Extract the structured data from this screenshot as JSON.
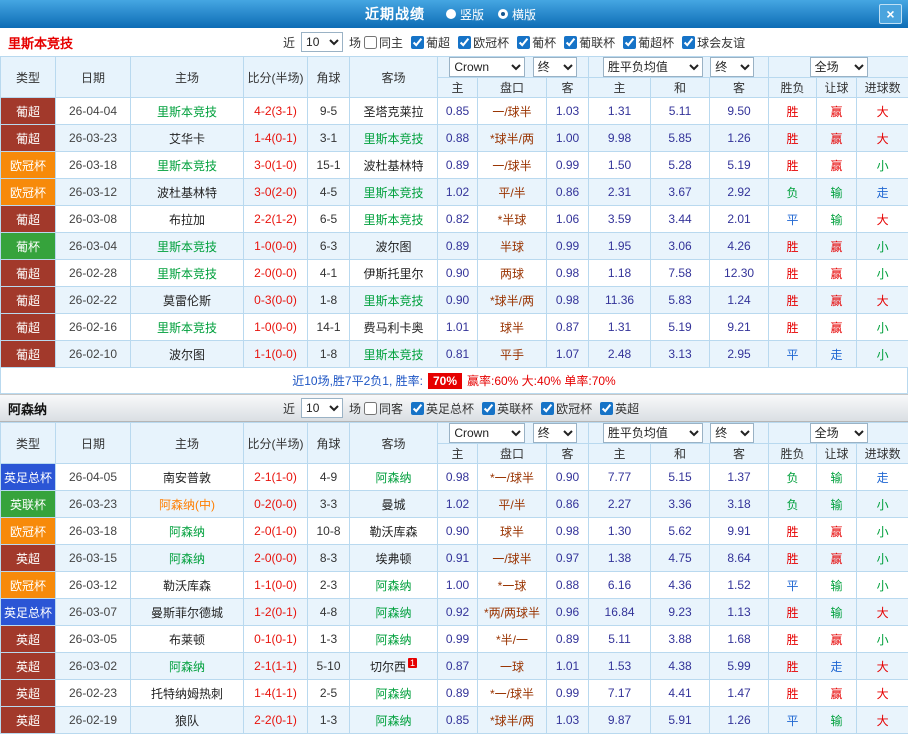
{
  "titlebar": {
    "title": "近期战绩",
    "options": [
      {
        "label": "竖版",
        "selected": false
      },
      {
        "label": "横版",
        "selected": true
      }
    ],
    "close": "×"
  },
  "league_colors": {
    "葡超": "#a2392b",
    "英超": "#a2392b",
    "欧冠杯": "#f78a0a",
    "葡杯": "#36a33c",
    "英联杯": "#36a33c",
    "英足总杯": "#2b55d5"
  },
  "result_classes": {
    "胜": "win",
    "赢": "win",
    "大": "win",
    "平": "push",
    "走": "push",
    "负": "loss",
    "输": "loss",
    "小": "loss"
  },
  "sections": [
    {
      "team": "里斯本竞技",
      "filters": {
        "near": "近",
        "count": "10",
        "games": "场",
        "checkboxes": [
          {
            "label": "同主",
            "checked": false
          },
          {
            "label": "葡超",
            "checked": true
          },
          {
            "label": "欧冠杯",
            "checked": true
          },
          {
            "label": "葡杯",
            "checked": true
          },
          {
            "label": "葡联杯",
            "checked": true
          },
          {
            "label": "葡超杯",
            "checked": true
          },
          {
            "label": "球会友谊",
            "checked": true
          }
        ]
      },
      "headers": {
        "type": "类型",
        "date": "日期",
        "home": "主场",
        "score": "比分(半场)",
        "corner": "角球",
        "away": "客场",
        "book": "Crown",
        "final1": "终",
        "avg": "胜平负均值",
        "final2": "终",
        "scope": "全场",
        "sub": [
          "主",
          "盘口",
          "客",
          "主",
          "和",
          "客",
          "胜负",
          "让球",
          "进球数"
        ]
      },
      "rows": [
        {
          "league": "葡超",
          "date": "26-04-04",
          "home": "里斯本竞技",
          "home_style": "self",
          "score": "4-2(3-1)",
          "corners": "9-5",
          "away": "圣塔克莱拉",
          "away_style": "",
          "asian": [
            "0.85",
            "一/球半",
            "1.03"
          ],
          "euro": [
            "1.31",
            "5.11",
            "9.50"
          ],
          "results": [
            "胜",
            "赢",
            "大"
          ]
        },
        {
          "league": "葡超",
          "date": "26-03-23",
          "home": "艾华卡",
          "home_style": "",
          "score": "1-4(0-1)",
          "corners": "3-1",
          "away": "里斯本竞技",
          "away_style": "self",
          "asian": [
            "0.88",
            "*球半/两",
            "1.00"
          ],
          "euro": [
            "9.98",
            "5.85",
            "1.26"
          ],
          "results": [
            "胜",
            "赢",
            "大"
          ]
        },
        {
          "league": "欧冠杯",
          "date": "26-03-18",
          "home": "里斯本竞技",
          "home_style": "self",
          "score": "3-0(1-0)",
          "corners": "15-1",
          "away": "波杜基林特",
          "away_style": "",
          "asian": [
            "0.89",
            "一/球半",
            "0.99"
          ],
          "euro": [
            "1.50",
            "5.28",
            "5.19"
          ],
          "results": [
            "胜",
            "赢",
            "小"
          ]
        },
        {
          "league": "欧冠杯",
          "date": "26-03-12",
          "home": "波杜基林特",
          "home_style": "",
          "score": "3-0(2-0)",
          "corners": "4-5",
          "away": "里斯本竞技",
          "away_style": "self",
          "asian": [
            "1.02",
            "平/半",
            "0.86"
          ],
          "euro": [
            "2.31",
            "3.67",
            "2.92"
          ],
          "results": [
            "负",
            "输",
            "走"
          ]
        },
        {
          "league": "葡超",
          "date": "26-03-08",
          "home": "布拉加",
          "home_style": "",
          "score": "2-2(1-2)",
          "corners": "6-5",
          "away": "里斯本竞技",
          "away_style": "self",
          "asian": [
            "0.82",
            "*半球",
            "1.06"
          ],
          "euro": [
            "3.59",
            "3.44",
            "2.01"
          ],
          "results": [
            "平",
            "输",
            "大"
          ]
        },
        {
          "league": "葡杯",
          "date": "26-03-04",
          "home": "里斯本竞技",
          "home_style": "self",
          "score": "1-0(0-0)",
          "corners": "6-3",
          "away": "波尔图",
          "away_style": "",
          "asian": [
            "0.89",
            "半球",
            "0.99"
          ],
          "euro": [
            "1.95",
            "3.06",
            "4.26"
          ],
          "results": [
            "胜",
            "赢",
            "小"
          ]
        },
        {
          "league": "葡超",
          "date": "26-02-28",
          "home": "里斯本竞技",
          "home_style": "self",
          "score": "2-0(0-0)",
          "corners": "4-1",
          "away": "伊斯托里尔",
          "away_style": "",
          "asian": [
            "0.90",
            "两球",
            "0.98"
          ],
          "euro": [
            "1.18",
            "7.58",
            "12.30"
          ],
          "results": [
            "胜",
            "赢",
            "小"
          ]
        },
        {
          "league": "葡超",
          "date": "26-02-22",
          "home": "莫雷伦斯",
          "home_style": "",
          "score": "0-3(0-0)",
          "corners": "1-8",
          "away": "里斯本竞技",
          "away_style": "self",
          "asian": [
            "0.90",
            "*球半/两",
            "0.98"
          ],
          "euro": [
            "11.36",
            "5.83",
            "1.24"
          ],
          "results": [
            "胜",
            "赢",
            "大"
          ]
        },
        {
          "league": "葡超",
          "date": "26-02-16",
          "home": "里斯本竞技",
          "home_style": "self",
          "score": "1-0(0-0)",
          "corners": "14-1",
          "away": "费马利卡奥",
          "away_style": "",
          "asian": [
            "1.01",
            "球半",
            "0.87"
          ],
          "euro": [
            "1.31",
            "5.19",
            "9.21"
          ],
          "results": [
            "胜",
            "赢",
            "小"
          ]
        },
        {
          "league": "葡超",
          "date": "26-02-10",
          "home": "波尔图",
          "home_style": "",
          "score": "1-1(0-0)",
          "corners": "1-8",
          "away": "里斯本竞技",
          "away_style": "self",
          "asian": [
            "0.81",
            "平手",
            "1.07"
          ],
          "euro": [
            "2.48",
            "3.13",
            "2.95"
          ],
          "results": [
            "平",
            "走",
            "小"
          ]
        }
      ],
      "summary": {
        "prefix": "近10场,胜7平2负1, 胜率:",
        "rate": "70%",
        "suffix": "赢率:60% 大:40% 单率:70%"
      }
    },
    {
      "team": "阿森纳",
      "filters": {
        "near": "近",
        "count": "10",
        "games": "场",
        "checkboxes": [
          {
            "label": "同客",
            "checked": false
          },
          {
            "label": "英足总杯",
            "checked": true
          },
          {
            "label": "英联杯",
            "checked": true
          },
          {
            "label": "欧冠杯",
            "checked": true
          },
          {
            "label": "英超",
            "checked": true
          }
        ]
      },
      "headers": {
        "type": "类型",
        "date": "日期",
        "home": "主场",
        "score": "比分(半场)",
        "corner": "角球",
        "away": "客场",
        "book": "Crown",
        "final1": "终",
        "avg": "胜平负均值",
        "final2": "终",
        "scope": "全场",
        "sub": [
          "主",
          "盘口",
          "客",
          "主",
          "和",
          "客",
          "胜负",
          "让球",
          "进球数"
        ]
      },
      "rows": [
        {
          "league": "英足总杯",
          "date": "26-04-05",
          "home": "南安普敦",
          "home_style": "",
          "score": "2-1(1-0)",
          "corners": "4-9",
          "away": "阿森纳",
          "away_style": "self",
          "asian": [
            "0.98",
            "*一/球半",
            "0.90"
          ],
          "euro": [
            "7.77",
            "5.15",
            "1.37"
          ],
          "results": [
            "负",
            "输",
            "走"
          ]
        },
        {
          "league": "英联杯",
          "date": "26-03-23",
          "home": "阿森纳(中)",
          "home_style": "mid",
          "score": "0-2(0-0)",
          "corners": "3-3",
          "away": "曼城",
          "away_style": "",
          "asian": [
            "1.02",
            "平/半",
            "0.86"
          ],
          "euro": [
            "2.27",
            "3.36",
            "3.18"
          ],
          "results": [
            "负",
            "输",
            "小"
          ]
        },
        {
          "league": "欧冠杯",
          "date": "26-03-18",
          "home": "阿森纳",
          "home_style": "self",
          "score": "2-0(1-0)",
          "corners": "10-8",
          "away": "勒沃库森",
          "away_style": "",
          "asian": [
            "0.90",
            "球半",
            "0.98"
          ],
          "euro": [
            "1.30",
            "5.62",
            "9.91"
          ],
          "results": [
            "胜",
            "赢",
            "小"
          ]
        },
        {
          "league": "英超",
          "date": "26-03-15",
          "home": "阿森纳",
          "home_style": "self",
          "score": "2-0(0-0)",
          "corners": "8-3",
          "away": "埃弗顿",
          "away_style": "",
          "asian": [
            "0.91",
            "一/球半",
            "0.97"
          ],
          "euro": [
            "1.38",
            "4.75",
            "8.64"
          ],
          "results": [
            "胜",
            "赢",
            "小"
          ]
        },
        {
          "league": "欧冠杯",
          "date": "26-03-12",
          "home": "勒沃库森",
          "home_style": "",
          "score": "1-1(0-0)",
          "corners": "2-3",
          "away": "阿森纳",
          "away_style": "self",
          "asian": [
            "1.00",
            "*一球",
            "0.88"
          ],
          "euro": [
            "6.16",
            "4.36",
            "1.52"
          ],
          "results": [
            "平",
            "输",
            "小"
          ]
        },
        {
          "league": "英足总杯",
          "date": "26-03-07",
          "home": "曼斯菲尔德城",
          "home_style": "",
          "score": "1-2(0-1)",
          "corners": "4-8",
          "away": "阿森纳",
          "away_style": "self",
          "asian": [
            "0.92",
            "*两/两球半",
            "0.96"
          ],
          "euro": [
            "16.84",
            "9.23",
            "1.13"
          ],
          "results": [
            "胜",
            "输",
            "大"
          ]
        },
        {
          "league": "英超",
          "date": "26-03-05",
          "home": "布莱顿",
          "home_style": "",
          "score": "0-1(0-1)",
          "corners": "1-3",
          "away": "阿森纳",
          "away_style": "self",
          "asian": [
            "0.99",
            "*半/一",
            "0.89"
          ],
          "euro": [
            "5.11",
            "3.88",
            "1.68"
          ],
          "results": [
            "胜",
            "赢",
            "小"
          ]
        },
        {
          "league": "英超",
          "date": "26-03-02",
          "home": "阿森纳",
          "home_style": "self",
          "score": "2-1(1-1)",
          "corners": "5-10",
          "away": "切尔西",
          "away_style": "",
          "away_card": "1",
          "asian": [
            "0.87",
            "一球",
            "1.01"
          ],
          "euro": [
            "1.53",
            "4.38",
            "5.99"
          ],
          "results": [
            "胜",
            "走",
            "大"
          ]
        },
        {
          "league": "英超",
          "date": "26-02-23",
          "home": "托特纳姆热刺",
          "home_style": "",
          "score": "1-4(1-1)",
          "corners": "2-5",
          "away": "阿森纳",
          "away_style": "self",
          "asian": [
            "0.89",
            "*一/球半",
            "0.99"
          ],
          "euro": [
            "7.17",
            "4.41",
            "1.47"
          ],
          "results": [
            "胜",
            "赢",
            "大"
          ]
        },
        {
          "league": "英超",
          "date": "26-02-19",
          "home": "狼队",
          "home_style": "",
          "score": "2-2(0-1)",
          "corners": "1-3",
          "away": "阿森纳",
          "away_style": "self",
          "asian": [
            "0.85",
            "*球半/两",
            "1.03"
          ],
          "euro": [
            "9.87",
            "5.91",
            "1.26"
          ],
          "results": [
            "平",
            "输",
            "大"
          ]
        }
      ]
    }
  ]
}
